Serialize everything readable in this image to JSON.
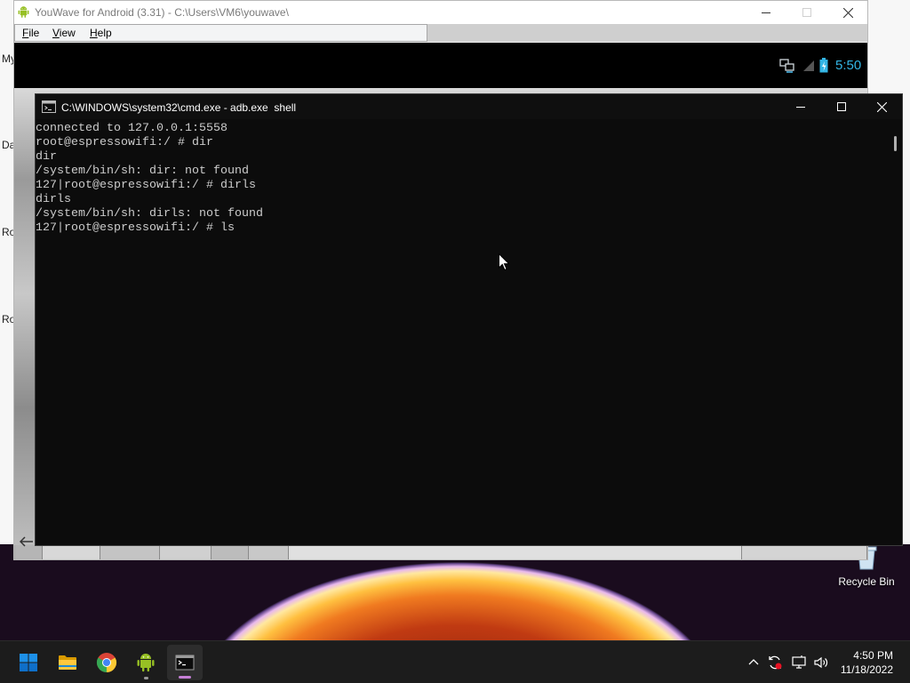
{
  "background_window": {
    "labels": [
      "My",
      "Da",
      "Ro",
      "Ro"
    ]
  },
  "youwave": {
    "title": "YouWave for Android (3.31) - C:\\Users\\VM6\\youwave\\",
    "menu": {
      "file": "File",
      "view": "View",
      "help": "Help"
    },
    "status_icons": [
      "network-icon",
      "signal-icon",
      "battery-icon"
    ],
    "status_time": "5:50"
  },
  "cmd": {
    "title": "C:\\WINDOWS\\system32\\cmd.exe - adb.exe  shell",
    "lines": [
      "connected to 127.0.0.1:5558",
      "root@espressowifi:/ # dir",
      "dir",
      "/system/bin/sh: dir: not found",
      "127|root@espressowifi:/ # dirls",
      "dirls",
      "/system/bin/sh: dirls: not found",
      "127|root@espressowifi:/ # ls"
    ]
  },
  "desktop": {
    "recycle_bin": "Recycle Bin"
  },
  "taskbar": {
    "apps": [
      "start-icon",
      "file-explorer-icon",
      "chrome-icon",
      "youwave-icon",
      "cmd-icon"
    ],
    "active_app": "cmd-icon",
    "tray_icons": [
      "chevron-up-icon",
      "sync-icon",
      "network-icon",
      "volume-icon"
    ],
    "time": "4:50 PM",
    "date": "11/18/2022"
  },
  "colors": {
    "terminal_bg": "#0c0c0c",
    "terminal_text": "#cccccc",
    "taskbar_bg": "#1c1c1c",
    "active_indicator": "#c57fd6",
    "android_green": "#97c024",
    "android_blue": "#33b5e5"
  }
}
